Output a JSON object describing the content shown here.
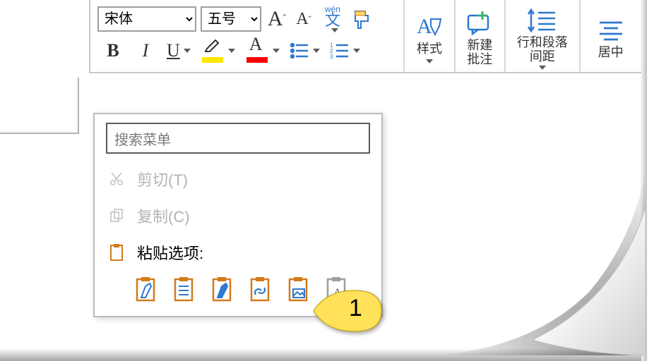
{
  "ribbon": {
    "font_name": "宋体",
    "font_size": "五号",
    "grow_font": "A",
    "shrink_font": "A",
    "phonetic_top": "wén",
    "phonetic_bottom": "文",
    "bold": "B",
    "italic": "I",
    "underline": "U",
    "font_color_letter": "A",
    "styles_label": "样式",
    "comment_label": "新建\n批注",
    "spacing_label": "行和段落\n间距",
    "align_label": "居中"
  },
  "context_menu": {
    "search_placeholder": "搜索菜单",
    "cut": "剪切(T)",
    "copy": "复制(C)",
    "paste_header": "粘贴选项:",
    "paste_options": [
      "keep-source-formatting",
      "merge-formatting",
      "use-destination-theme",
      "paste-link",
      "picture",
      "keep-text-only"
    ]
  },
  "callout": {
    "number": "1"
  },
  "colors": {
    "accent": "#2e78d0",
    "orange": "#d37b1a",
    "highlight": "#ffe600",
    "font_color": "#ff0000"
  }
}
